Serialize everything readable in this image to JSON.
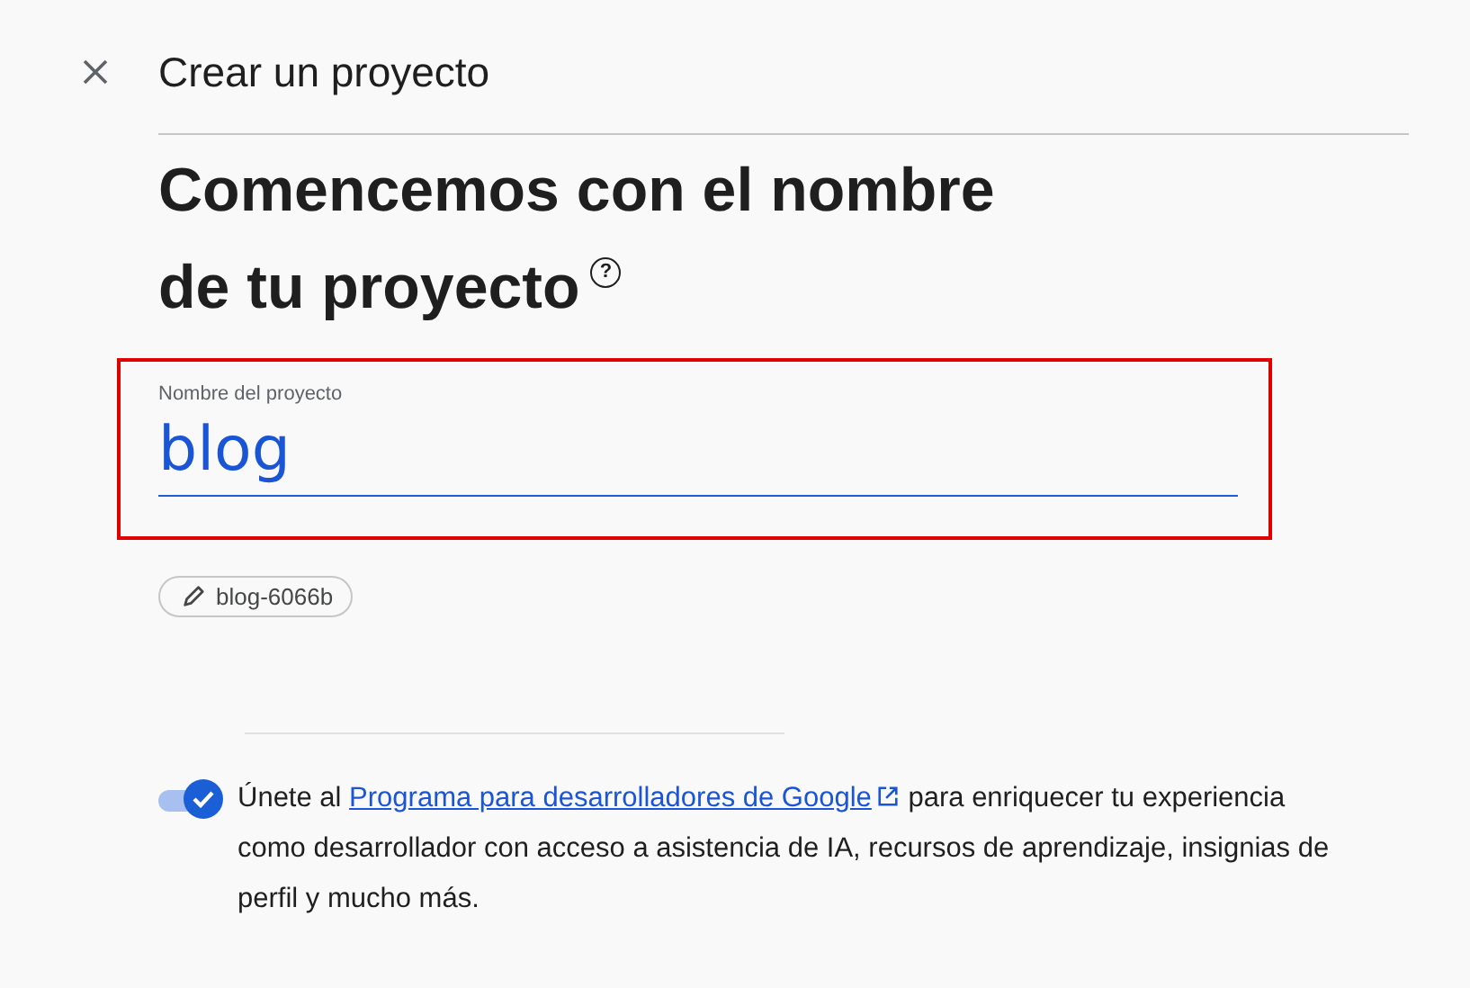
{
  "header": {
    "title": "Crear un proyecto"
  },
  "heading": {
    "lines": [
      "Comencemos con el nombre",
      "de tu proyecto"
    ],
    "help_mark": "?"
  },
  "project_name_field": {
    "label": "Nombre del proyecto",
    "value": "blog",
    "highlighted": true
  },
  "project_id_chip": {
    "text": "blog-6066b"
  },
  "developer_program": {
    "on": true,
    "text_before": "Únete al",
    "link": "Programa para desarrolladores de Google",
    "text_after": "para enriquecer tu experiencia como desarrollador con acceso a asistencia de IA, recursos de aprendizaje, insignias de perfil y mucho más."
  }
}
